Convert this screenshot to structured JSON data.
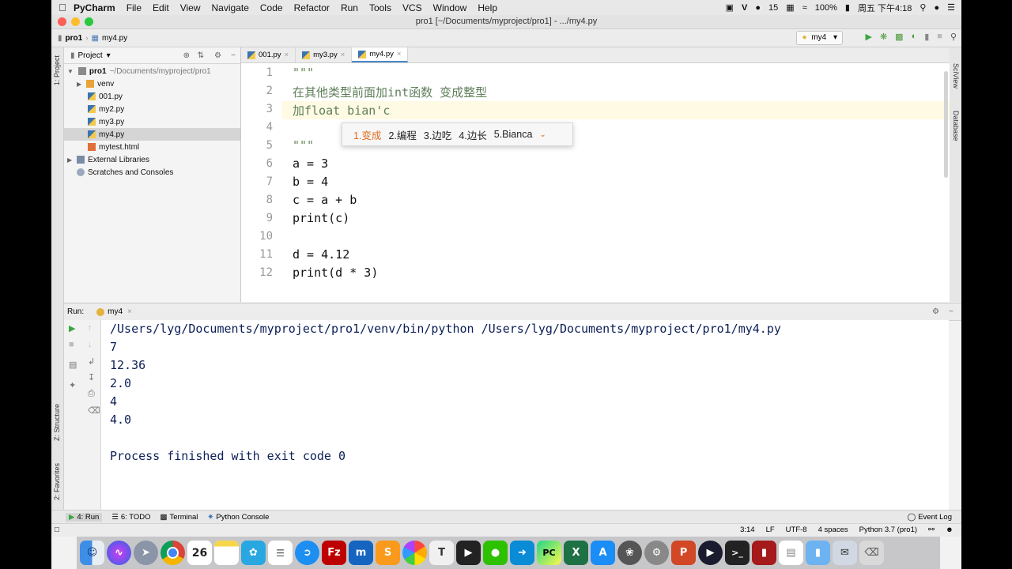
{
  "menubar": {
    "app_name": "PyCharm",
    "items": [
      "File",
      "Edit",
      "View",
      "Navigate",
      "Code",
      "Refactor",
      "Run",
      "Tools",
      "VCS",
      "Window",
      "Help"
    ],
    "status_count": "15",
    "battery": "100%",
    "clock": "周五 下午4:18"
  },
  "window": {
    "title": "pro1 [~/Documents/myproject/pro1] - .../my4.py"
  },
  "navbar": {
    "crumb_project": "pro1",
    "crumb_file": "my4.py",
    "run_config": "my4"
  },
  "side_strips": {
    "project_label": "1: Project",
    "sciview_label": "SciView",
    "database_label": "Database",
    "structure_label": "Z: Structure",
    "favorites_label": "2: Favorites"
  },
  "project_panel": {
    "title": "Project",
    "root_name": "pro1",
    "root_path": "~/Documents/myproject/pro1",
    "items": [
      {
        "label": "venv",
        "type": "folder"
      },
      {
        "label": "001.py",
        "type": "py"
      },
      {
        "label": "my2.py",
        "type": "py"
      },
      {
        "label": "my3.py",
        "type": "py"
      },
      {
        "label": "my4.py",
        "type": "py"
      },
      {
        "label": "mytest.html",
        "type": "html"
      }
    ],
    "external_libraries": "External Libraries",
    "scratches": "Scratches and Consoles"
  },
  "editor_tabs": [
    {
      "label": "001.py"
    },
    {
      "label": "my3.py"
    },
    {
      "label": "my4.py"
    }
  ],
  "editor": {
    "line_numbers": [
      "1",
      "2",
      "3",
      "4",
      "5",
      "6",
      "7",
      "8",
      "9",
      "10",
      "11",
      "12"
    ],
    "lines": [
      "\"\"\"",
      "在其他类型前面加int函数 变成整型",
      "加float bian'c",
      "",
      "\"\"\"",
      "a = 3",
      "b = 4",
      "c = a + b",
      "print(c)",
      "",
      "d = 4.12",
      "print(d * 3)"
    ]
  },
  "ime_popup": {
    "candidates": [
      "1.变成",
      "2.编程",
      "3.边吃",
      "4.边长",
      "5.Bianca"
    ]
  },
  "run_panel": {
    "label": "Run:",
    "tab": "my4",
    "output": [
      "/Users/lyg/Documents/myproject/pro1/venv/bin/python /Users/lyg/Documents/myproject/pro1/my4.py",
      "7",
      "12.36",
      "2.0",
      "4",
      "4.0",
      "",
      "Process finished with exit code 0"
    ]
  },
  "bottom_tools": {
    "run": "4: Run",
    "todo": "6: TODO",
    "terminal": "Terminal",
    "python_console": "Python Console",
    "event_log": "Event Log"
  },
  "statusbar": {
    "position": "3:14",
    "line_sep": "LF",
    "encoding": "UTF-8",
    "indent": "4 spaces",
    "interpreter": "Python 3.7 (pro1)"
  },
  "dock": {
    "icons": [
      "finder-icon",
      "siri-icon",
      "launchpad-icon",
      "chrome-icon",
      "calendar-icon",
      "notes-icon",
      "mindmap-icon",
      "reminders-icon",
      "safari-icon",
      "filezilla-icon",
      "mindnode-icon",
      "sublime-icon",
      "photos-icon",
      "typora-icon",
      "finalcut-icon",
      "wechat-icon",
      "migration-icon",
      "pycharm-icon",
      "excel-icon",
      "appstore-icon",
      "davinci-icon",
      "settings-icon",
      "powerpoint-icon",
      "quicktime-icon",
      "terminal-icon",
      "winrar-icon",
      "document-icon",
      "folder-icon",
      "mail-icon",
      "trash-icon"
    ],
    "calendar_day": "26"
  }
}
